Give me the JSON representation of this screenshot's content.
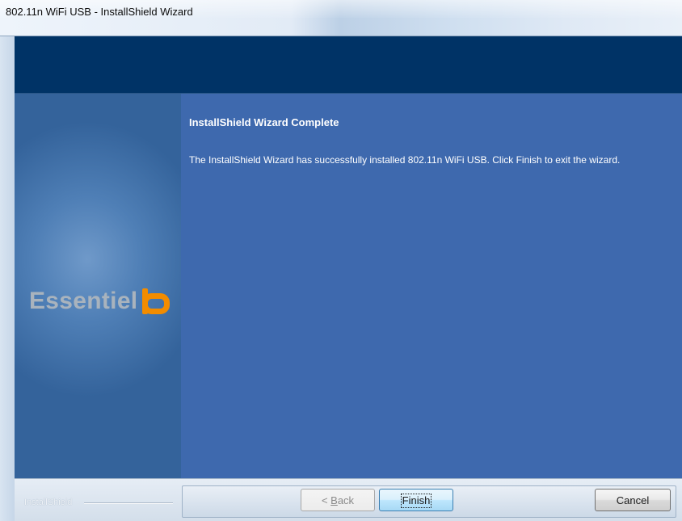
{
  "window": {
    "title": "802.11n WiFi USB - InstallShield Wizard"
  },
  "side": {
    "logo_text": "Essentiel",
    "logo_mark_color": "#f28c00"
  },
  "main": {
    "title": "InstallShield Wizard Complete",
    "body": "The InstallShield Wizard has successfully installed 802.11n WiFi USB.  Click Finish to exit the wizard."
  },
  "footer": {
    "brand": "InstallShield"
  },
  "buttons": {
    "back_prefix": "< ",
    "back_mnemonic": "B",
    "back_rest": "ack",
    "finish_label": "Finish",
    "cancel_label": "Cancel"
  },
  "colors": {
    "header_band": "#003366",
    "main_panel": "#3e69ae",
    "side_panel": "#4f7fb6"
  }
}
